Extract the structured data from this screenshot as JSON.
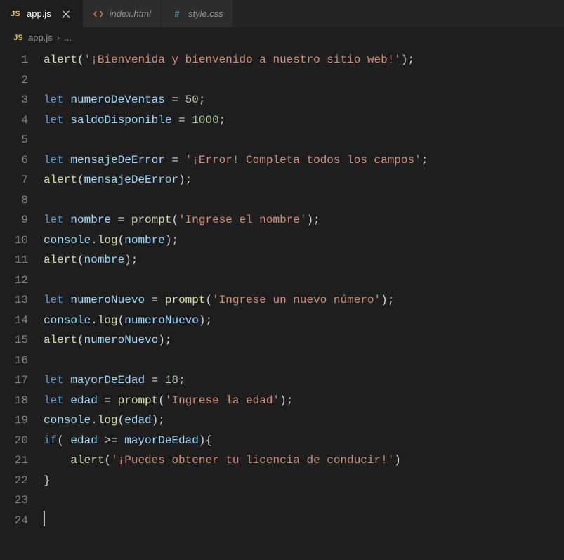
{
  "tabs": [
    {
      "label": "app.js",
      "icon": "JS",
      "active": true
    },
    {
      "label": "index.html",
      "icon": "html",
      "active": false
    },
    {
      "label": "style.css",
      "icon": "#",
      "active": false
    }
  ],
  "breadcrumb": {
    "icon": "JS",
    "file": "app.js",
    "chevron": "›",
    "ellipsis": "..."
  },
  "code": {
    "lines": [
      [
        {
          "t": "fn",
          "v": "alert"
        },
        {
          "t": "punc",
          "v": "("
        },
        {
          "t": "str",
          "v": "'¡Bienvenida y bienvenido a nuestro sitio web!'"
        },
        {
          "t": "punc",
          "v": ");"
        }
      ],
      [],
      [
        {
          "t": "kw",
          "v": "let"
        },
        {
          "t": "punc",
          "v": " "
        },
        {
          "t": "var",
          "v": "numeroDeVentas"
        },
        {
          "t": "punc",
          "v": " = "
        },
        {
          "t": "num",
          "v": "50"
        },
        {
          "t": "punc",
          "v": ";"
        }
      ],
      [
        {
          "t": "kw",
          "v": "let"
        },
        {
          "t": "punc",
          "v": " "
        },
        {
          "t": "var",
          "v": "saldoDisponible"
        },
        {
          "t": "punc",
          "v": " = "
        },
        {
          "t": "num",
          "v": "1000"
        },
        {
          "t": "punc",
          "v": ";"
        }
      ],
      [],
      [
        {
          "t": "kw",
          "v": "let"
        },
        {
          "t": "punc",
          "v": " "
        },
        {
          "t": "var",
          "v": "mensajeDeError"
        },
        {
          "t": "punc",
          "v": " = "
        },
        {
          "t": "str",
          "v": "'¡Error! Completa todos los campos'"
        },
        {
          "t": "punc",
          "v": ";"
        }
      ],
      [
        {
          "t": "fn",
          "v": "alert"
        },
        {
          "t": "punc",
          "v": "("
        },
        {
          "t": "var",
          "v": "mensajeDeError"
        },
        {
          "t": "punc",
          "v": ");"
        }
      ],
      [],
      [
        {
          "t": "kw",
          "v": "let"
        },
        {
          "t": "punc",
          "v": " "
        },
        {
          "t": "var",
          "v": "nombre"
        },
        {
          "t": "punc",
          "v": " = "
        },
        {
          "t": "fn",
          "v": "prompt"
        },
        {
          "t": "punc",
          "v": "("
        },
        {
          "t": "str",
          "v": "'Ingrese el nombre'"
        },
        {
          "t": "punc",
          "v": ");"
        }
      ],
      [
        {
          "t": "var",
          "v": "console"
        },
        {
          "t": "punc",
          "v": "."
        },
        {
          "t": "fn",
          "v": "log"
        },
        {
          "t": "punc",
          "v": "("
        },
        {
          "t": "var",
          "v": "nombre"
        },
        {
          "t": "punc",
          "v": ");"
        }
      ],
      [
        {
          "t": "fn",
          "v": "alert"
        },
        {
          "t": "punc",
          "v": "("
        },
        {
          "t": "var",
          "v": "nombre"
        },
        {
          "t": "punc",
          "v": ");"
        }
      ],
      [],
      [
        {
          "t": "kw",
          "v": "let"
        },
        {
          "t": "punc",
          "v": " "
        },
        {
          "t": "var",
          "v": "numeroNuevo"
        },
        {
          "t": "punc",
          "v": " = "
        },
        {
          "t": "fn",
          "v": "prompt"
        },
        {
          "t": "punc",
          "v": "("
        },
        {
          "t": "str",
          "v": "'Ingrese un nuevo número'"
        },
        {
          "t": "punc",
          "v": ");"
        }
      ],
      [
        {
          "t": "var",
          "v": "console"
        },
        {
          "t": "punc",
          "v": "."
        },
        {
          "t": "fn",
          "v": "log"
        },
        {
          "t": "punc",
          "v": "("
        },
        {
          "t": "var",
          "v": "numeroNuevo"
        },
        {
          "t": "punc",
          "v": ");"
        }
      ],
      [
        {
          "t": "fn",
          "v": "alert"
        },
        {
          "t": "punc",
          "v": "("
        },
        {
          "t": "var",
          "v": "numeroNuevo"
        },
        {
          "t": "punc",
          "v": ");"
        }
      ],
      [],
      [
        {
          "t": "kw",
          "v": "let"
        },
        {
          "t": "punc",
          "v": " "
        },
        {
          "t": "var",
          "v": "mayorDeEdad"
        },
        {
          "t": "punc",
          "v": " = "
        },
        {
          "t": "num",
          "v": "18"
        },
        {
          "t": "punc",
          "v": ";"
        }
      ],
      [
        {
          "t": "kw",
          "v": "let"
        },
        {
          "t": "punc",
          "v": " "
        },
        {
          "t": "var",
          "v": "edad"
        },
        {
          "t": "punc",
          "v": " = "
        },
        {
          "t": "fn",
          "v": "prompt"
        },
        {
          "t": "punc",
          "v": "("
        },
        {
          "t": "str",
          "v": "'Ingrese la edad'"
        },
        {
          "t": "punc",
          "v": ");"
        }
      ],
      [
        {
          "t": "var",
          "v": "console"
        },
        {
          "t": "punc",
          "v": "."
        },
        {
          "t": "fn",
          "v": "log"
        },
        {
          "t": "punc",
          "v": "("
        },
        {
          "t": "var",
          "v": "edad"
        },
        {
          "t": "punc",
          "v": ");"
        }
      ],
      [
        {
          "t": "kw",
          "v": "if"
        },
        {
          "t": "punc",
          "v": "( "
        },
        {
          "t": "var",
          "v": "edad"
        },
        {
          "t": "punc",
          "v": " >= "
        },
        {
          "t": "var",
          "v": "mayorDeEdad"
        },
        {
          "t": "punc",
          "v": "){"
        }
      ],
      [
        {
          "t": "guide",
          "v": "    "
        },
        {
          "t": "fn",
          "v": "alert"
        },
        {
          "t": "punc",
          "v": "("
        },
        {
          "t": "str",
          "v": "'¡Puedes obtener tu licencia de conducir!'"
        },
        {
          "t": "punc",
          "v": ")"
        }
      ],
      [
        {
          "t": "punc",
          "v": "}"
        }
      ],
      [],
      [
        {
          "t": "cursor",
          "v": ""
        }
      ]
    ]
  }
}
